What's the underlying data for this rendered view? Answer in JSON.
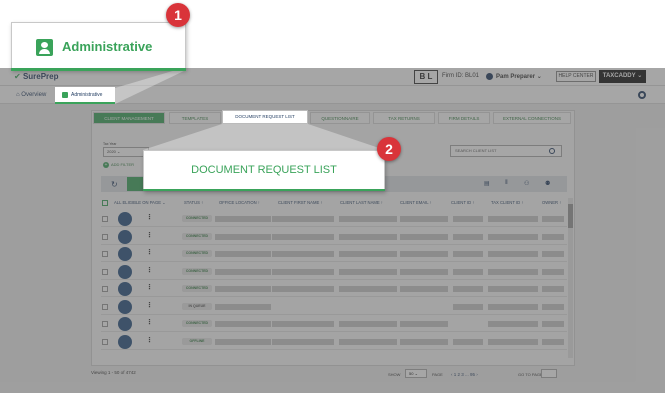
{
  "app": {
    "logo": "SurePrep",
    "firm_initials": "B L",
    "firm_id": "Firm ID: BL01",
    "user": "Pam Preparer",
    "help": "HELP CENTER",
    "taxcaddy": "TAXCADDY"
  },
  "nav": {
    "overview": "Overview",
    "administrative": "Administrative"
  },
  "tabs": [
    "CLIENT MANAGEMENT",
    "TEMPLATES",
    "DOCUMENT REQUEST LIST",
    "QUESTIONNAIRE",
    "TAX RETURNS",
    "FIRM DETAILS",
    "EXTERNAL CONNECTIONS"
  ],
  "filters": {
    "tax_year_label": "Tax Year",
    "tax_year_value": "2020",
    "add_filter": "ADD FILTER",
    "search_placeholder": "SEARCH CLIENT LIST"
  },
  "table": {
    "headers": [
      "ALL ELIGIBLE ON PAGE",
      "STATUS",
      "OFFICE LOCATION",
      "CLIENT FIRST NAME",
      "CLIENT LAST NAME",
      "CLIENT EMAIL",
      "CLIENT ID",
      "TAX CLIENT ID",
      "OWNER"
    ],
    "rows": [
      {
        "status": "CONNECTED"
      },
      {
        "status": "CONNECTED"
      },
      {
        "status": "CONNECTED"
      },
      {
        "status": "CONNECTED"
      },
      {
        "status": "CONNECTED"
      },
      {
        "status": "IN QUEUE"
      },
      {
        "status": "CONNECTED"
      },
      {
        "status": "OFFLINE"
      }
    ]
  },
  "footer": {
    "viewing": "Viewing 1 - 50 of 4742",
    "show_label": "SHOW",
    "show_value": "50",
    "page_label": "PAGE",
    "pages": "1 2 3 ... 95",
    "goto_label": "GO TO PAGE"
  },
  "callouts": [
    {
      "number": "1",
      "text": "Administrative"
    },
    {
      "number": "2",
      "text": "DOCUMENT REQUEST LIST"
    }
  ],
  "colors": {
    "accent": "#3aa35a",
    "badge": "#d9343a",
    "navy": "#1f3a5f"
  }
}
